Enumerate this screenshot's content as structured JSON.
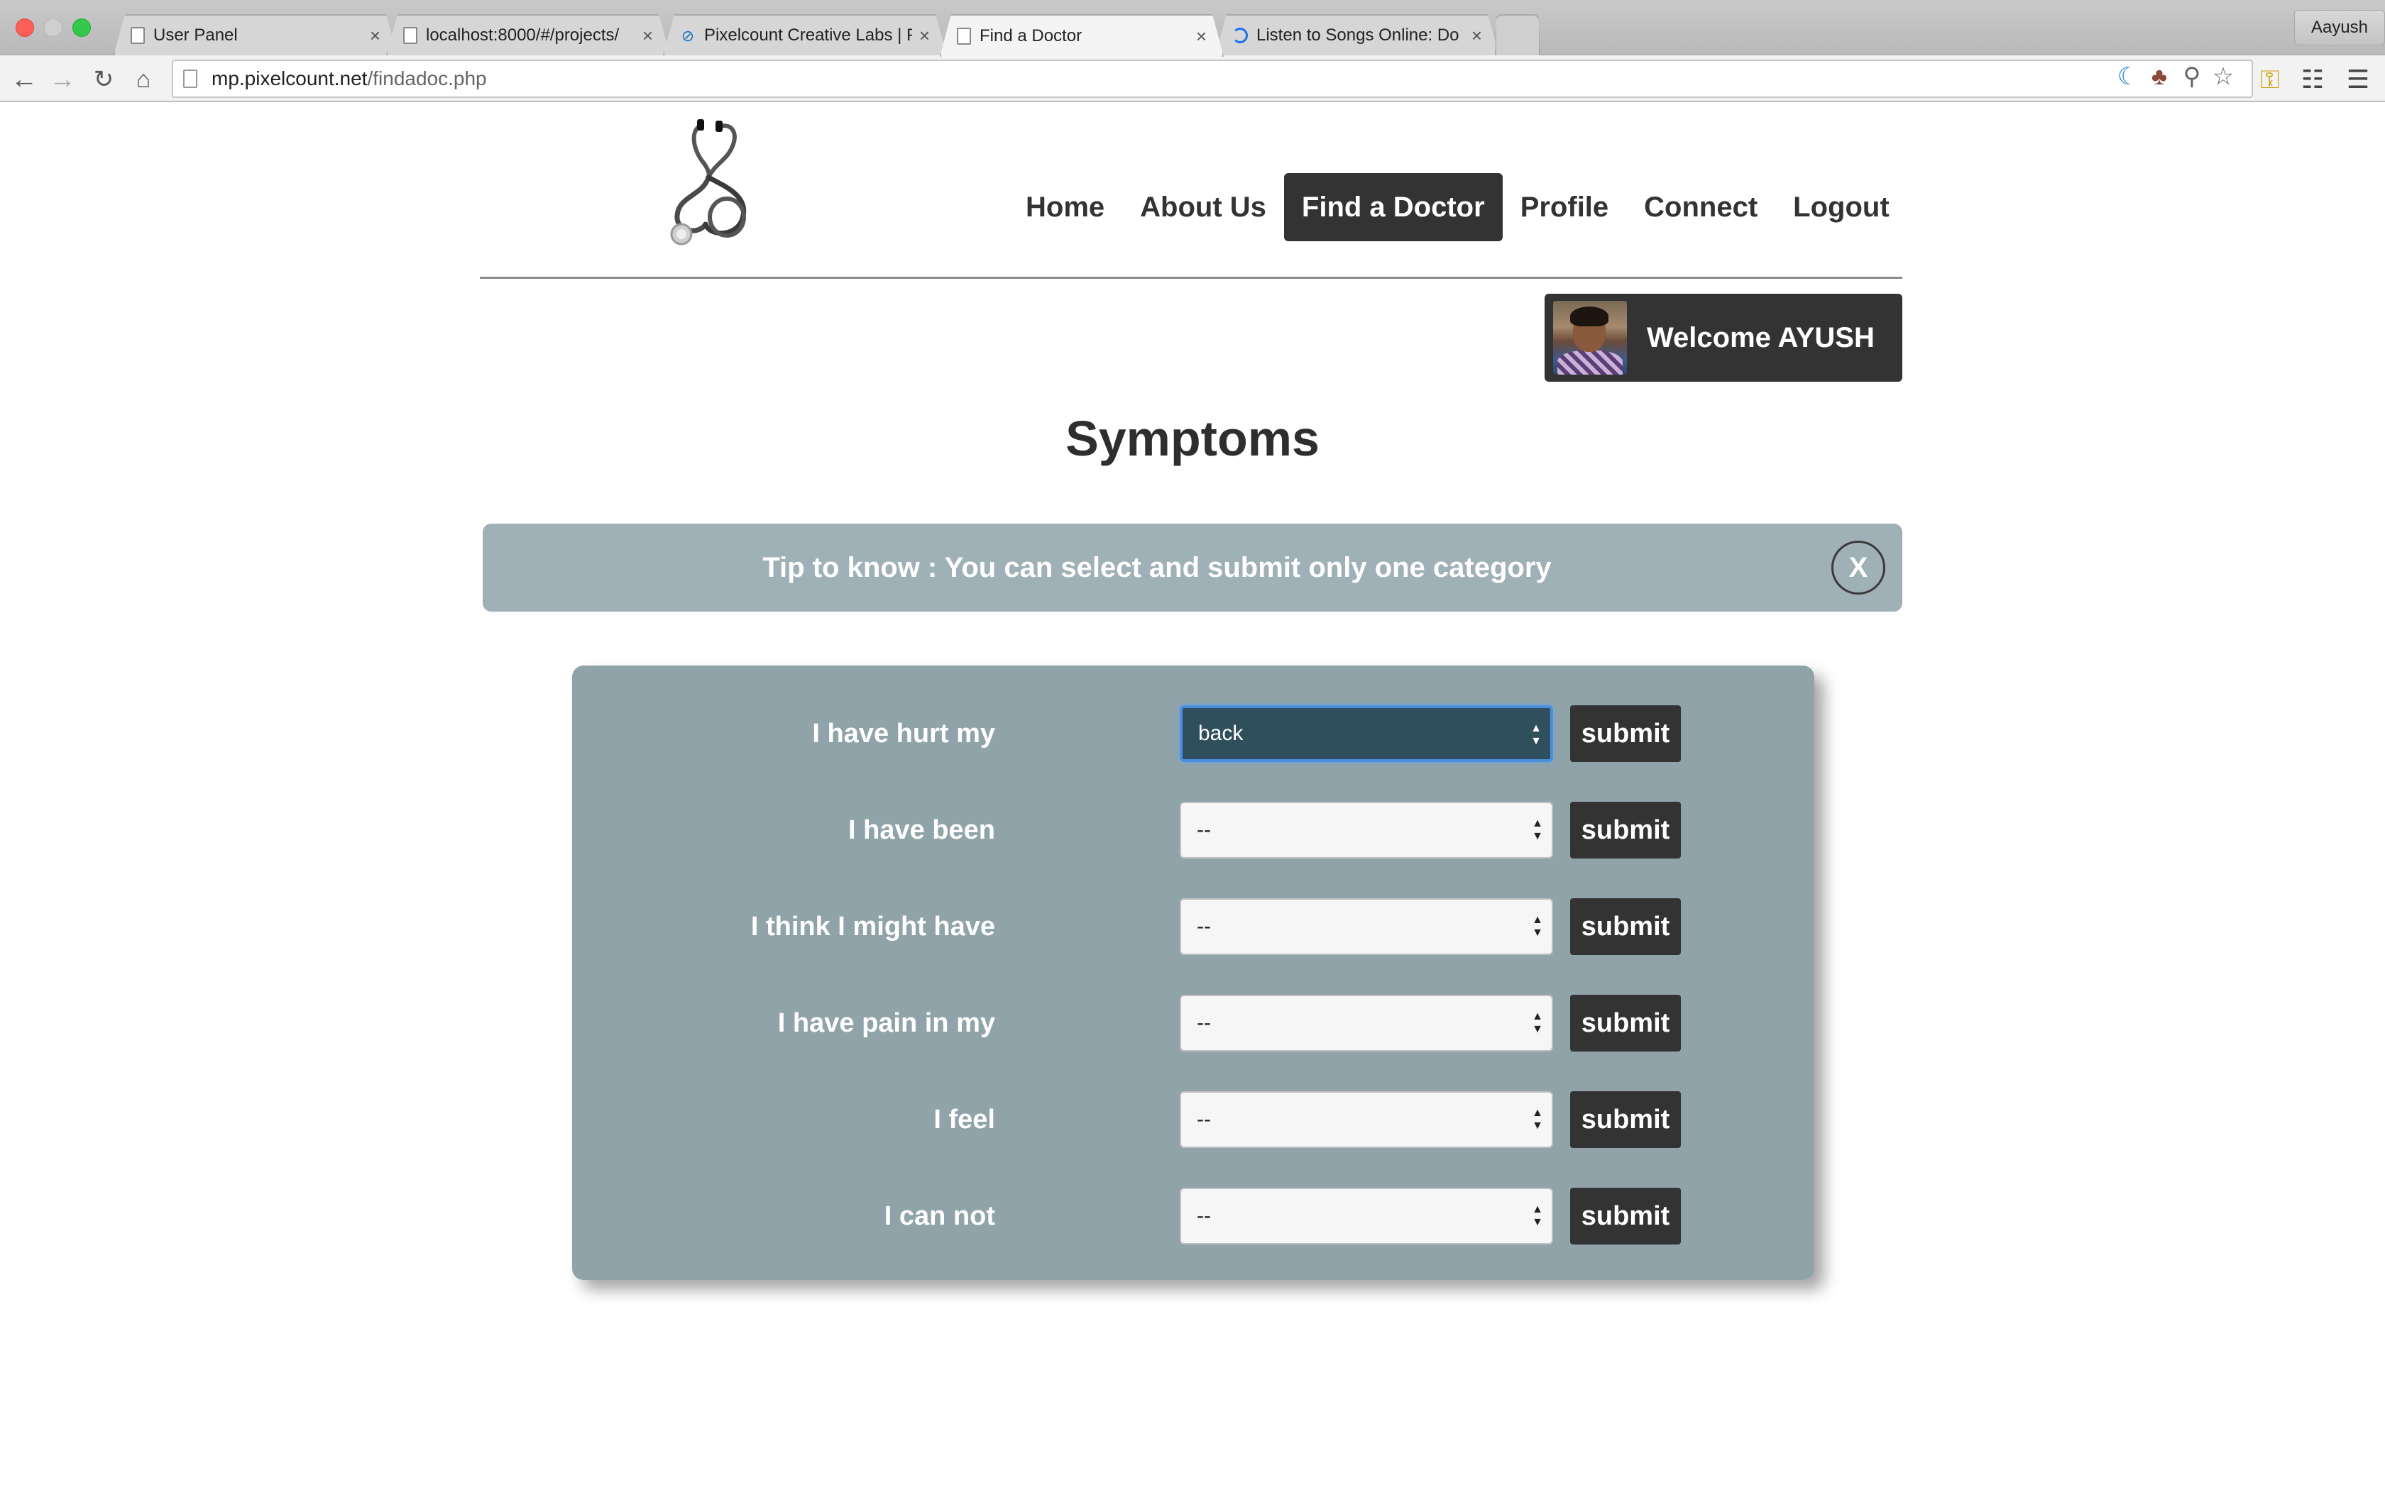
{
  "browser": {
    "tabs": [
      {
        "title": "User Panel",
        "active": false,
        "icon": "page-icon"
      },
      {
        "title": "localhost:8000/#/projects/",
        "active": false,
        "icon": "page-icon"
      },
      {
        "title": "Pixelcount Creative Labs | P",
        "active": false,
        "icon": "pixelcount-icon"
      },
      {
        "title": "Find a Doctor",
        "active": true,
        "icon": "page-icon"
      },
      {
        "title": "Listen to Songs Online: Do",
        "active": false,
        "icon": "loading-icon"
      }
    ],
    "profile_name": "Aayush",
    "url_host": "mp.pixelcount.net",
    "url_path": "/findadoc.php"
  },
  "site": {
    "logo_icon": "stethoscope-icon",
    "nav": [
      {
        "label": "Home",
        "active": false
      },
      {
        "label": "About Us",
        "active": false
      },
      {
        "label": "Find a Doctor",
        "active": true
      },
      {
        "label": "Profile",
        "active": false
      },
      {
        "label": "Connect",
        "active": false
      },
      {
        "label": "Logout",
        "active": false
      }
    ],
    "welcome_text": "Welcome AYUSH"
  },
  "main": {
    "heading": "Symptoms",
    "tip": {
      "text": "Tip to know : You can select and submit only one category",
      "close_label": "X"
    },
    "rows": [
      {
        "label": "I have hurt my",
        "value": "back",
        "focused": true,
        "submit_label": "submit"
      },
      {
        "label": "I have been",
        "value": "--",
        "focused": false,
        "submit_label": "submit"
      },
      {
        "label": "I think I might have",
        "value": "--",
        "focused": false,
        "submit_label": "submit"
      },
      {
        "label": "I have pain in my",
        "value": "--",
        "focused": false,
        "submit_label": "submit"
      },
      {
        "label": "I feel",
        "value": "--",
        "focused": false,
        "submit_label": "submit"
      },
      {
        "label": "I can not",
        "value": "--",
        "focused": false,
        "submit_label": "submit"
      }
    ]
  },
  "colors": {
    "nav_active_bg": "#333333",
    "tip_bg": "#9fb0b7",
    "panel_bg": "#8fa3a9",
    "focused_select_bg": "#2f4f5c"
  }
}
